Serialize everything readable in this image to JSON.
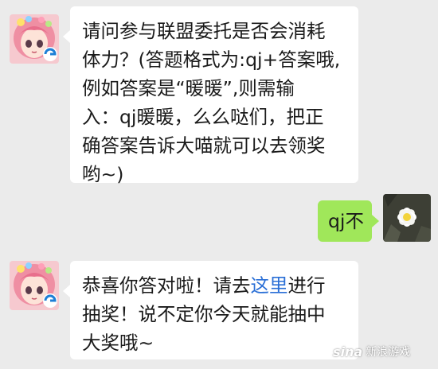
{
  "messages": [
    {
      "sender": "bot",
      "lines": [
        "请问参与联盟委托是否会消耗",
        "体力？(答题格式为:qj+答案哦,",
        "例如答案是“暖暖”,则需输",
        "入：qj暖暖，么么哒们，把正",
        "确答案告诉大喵就可以去领奖",
        "哟~)"
      ]
    },
    {
      "sender": "me",
      "text": "qj不"
    },
    {
      "sender": "bot",
      "line1_before": "恭喜你答对啦！请去",
      "line1_link": "这里",
      "line1_after": "进行",
      "line2": "抽奖！说不定你今天就能抽中",
      "line3": "大奖哦~"
    }
  ],
  "watermark": {
    "logo": "sina",
    "text": "新浪游戏"
  },
  "colors": {
    "background": "#ebebeb",
    "bot_bubble": "#ffffff",
    "my_bubble": "#a0e75a",
    "link": "#2a6fd6"
  }
}
